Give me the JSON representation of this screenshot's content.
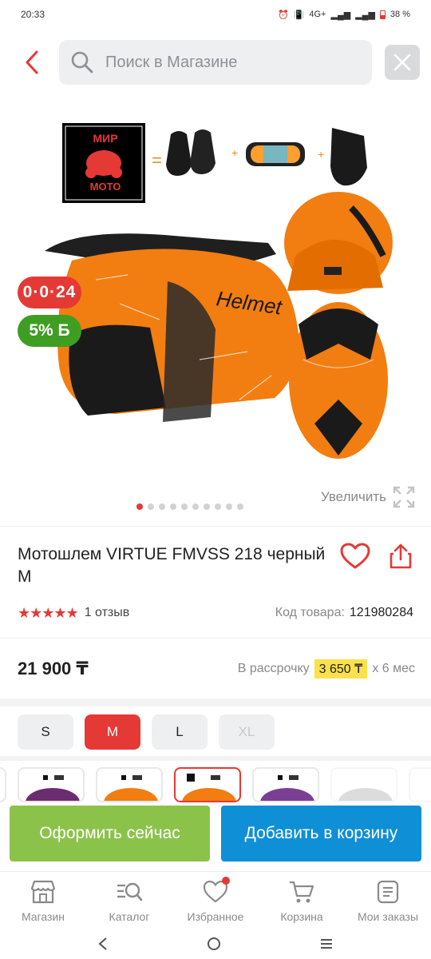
{
  "status_bar": {
    "time": "20:33",
    "network": "4G+",
    "battery": "38 %"
  },
  "search": {
    "placeholder": "Поиск в Магазине"
  },
  "gallery": {
    "installment_badge": "0·0·24",
    "cashback_badge": "5% Б",
    "zoom_label": "Увеличить",
    "dots_total": 10,
    "dots_active": 1
  },
  "product": {
    "title_line1": "Мотошлем VIRTUE FMVSS 218 черный",
    "title_line2": "M",
    "rating": 5,
    "stars": "★★★★★",
    "reviews": "1 отзыв",
    "code_label": "Код товара:",
    "code_value": "121980284",
    "price": "21 900 ₸",
    "installment_prefix": "В рассрочку",
    "installment_amount": "3 650 ₸",
    "installment_suffix": "x 6 мес"
  },
  "sizes": [
    {
      "label": "S",
      "state": "normal"
    },
    {
      "label": "M",
      "state": "selected"
    },
    {
      "label": "L",
      "state": "normal"
    },
    {
      "label": "XL",
      "state": "disabled"
    }
  ],
  "actions": {
    "buy_now": "Оформить сейчас",
    "add_to_cart": "Добавить в корзину"
  },
  "bottom_nav": [
    {
      "label": "Магазин",
      "icon": "store-icon"
    },
    {
      "label": "Каталог",
      "icon": "catalog-search-icon"
    },
    {
      "label": "Избранное",
      "icon": "heart-icon"
    },
    {
      "label": "Корзина",
      "icon": "cart-icon"
    },
    {
      "label": "Мои заказы",
      "icon": "orders-icon"
    }
  ],
  "colors": {
    "accent_red": "#e53935",
    "buy_green": "#8bc34a",
    "cart_blue": "#0f8fd6",
    "cashback_green": "#3f9e22",
    "installment_yellow": "#fbe14c"
  },
  "product_image_labels": {
    "logo_line1": "МИР",
    "logo_line2": "МОТО",
    "helmet_brand": "Helmet",
    "equals": "=",
    "plus": "+"
  }
}
